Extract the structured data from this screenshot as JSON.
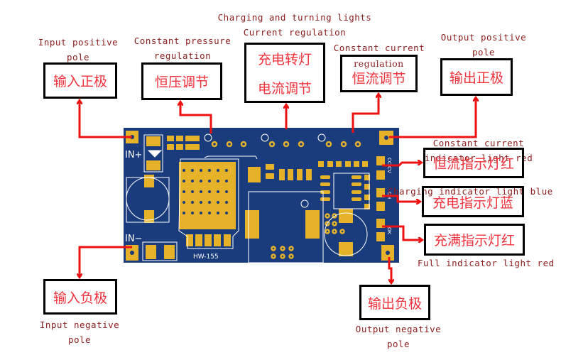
{
  "colors": {
    "board": "#1b3c7c",
    "pad": "#e5b22a",
    "arrow": "#ee1111",
    "label": "#8b1c1c",
    "box_text": "#f0303a"
  },
  "board": {
    "model": "HW-155",
    "in_plus": "IN+",
    "in_minus": "IN−",
    "cc_cv": "CC/CV",
    "ch": "CH",
    "ok": "OK"
  },
  "annotations": {
    "input_positive": {
      "en1": "Input positive",
      "en2": "pole",
      "zh": "输入正极"
    },
    "constant_pressure": {
      "en1": "Constant pressure",
      "en2": "regulation",
      "zh": "恒压调节"
    },
    "charging_turning": {
      "en1": "Charging and turning lights",
      "en2": "Current regulation",
      "zh1": "充电转灯",
      "zh2": "电流调节"
    },
    "constant_current": {
      "en1": "Constant current",
      "en2": "regulation",
      "zh": "恒流调节"
    },
    "output_positive": {
      "en1": "Output positive",
      "en2": "pole",
      "zh": "输出正极"
    },
    "cc_indicator": {
      "en1": "Constant current",
      "en2": "indicator light red",
      "zh": "恒流指示灯红"
    },
    "charging_indicator": {
      "en": "Charging indicator light blue",
      "zh": "充电指示灯蓝"
    },
    "full_indicator": {
      "en": "Full indicator light red",
      "zh": "充满指示灯红"
    },
    "input_negative": {
      "en1": "Input negative",
      "en2": "pole",
      "zh": "输入负极"
    },
    "output_negative": {
      "en1": "Output negative",
      "en2": "pole",
      "zh": "输出负极"
    }
  }
}
